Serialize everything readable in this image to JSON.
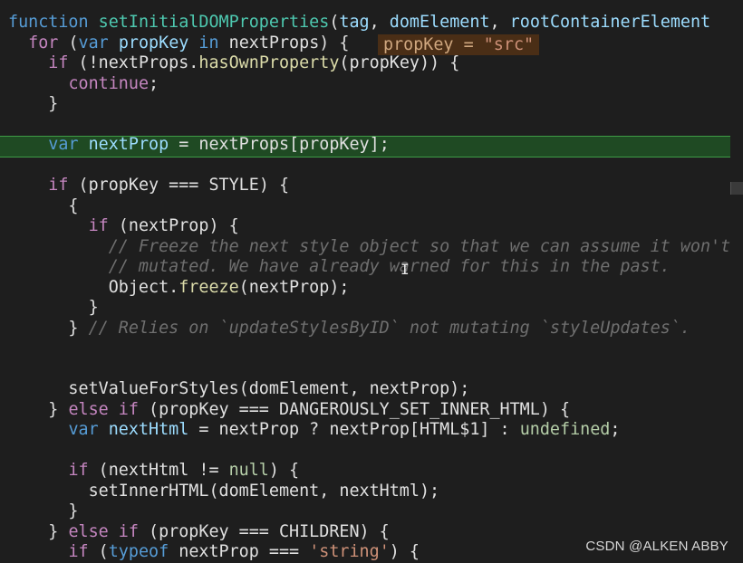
{
  "editor": {
    "language": "javascript",
    "inline_value": {
      "label": "propKey = ",
      "value": "\"src\""
    },
    "watermark": "CSDN @ALKEN  ABBY",
    "cursor_glyph": "I",
    "highlight_color": "#1f4a23",
    "lines": [
      [
        [
          "tk-keyword",
          "function "
        ],
        [
          "tk-function",
          "setInitialDOMProperties"
        ],
        [
          "tk-plain",
          "("
        ],
        [
          "tk-param",
          "tag"
        ],
        [
          "tk-plain",
          ", "
        ],
        [
          "tk-param",
          "domElement"
        ],
        [
          "tk-plain",
          ", "
        ],
        [
          "tk-param",
          "rootContainerElement"
        ]
      ],
      [
        [
          "tk-plain",
          "  "
        ],
        [
          "tk-control",
          "for "
        ],
        [
          "tk-plain",
          "("
        ],
        [
          "tk-keyword",
          "var "
        ],
        [
          "tk-var",
          "propKey "
        ],
        [
          "tk-keyword",
          "in "
        ],
        [
          "tk-plain",
          "nextProps) {"
        ]
      ],
      [
        [
          "tk-plain",
          "    "
        ],
        [
          "tk-control",
          "if "
        ],
        [
          "tk-plain",
          "(!nextProps."
        ],
        [
          "tk-yellowish",
          "hasOwnProperty"
        ],
        [
          "tk-plain",
          "(propKey)) {"
        ]
      ],
      [
        [
          "tk-plain",
          "      "
        ],
        [
          "tk-control",
          "continue"
        ],
        [
          "tk-plain",
          ";"
        ]
      ],
      [
        [
          "tk-plain",
          "    }"
        ]
      ],
      [
        [
          "tk-plain",
          ""
        ]
      ],
      [
        [
          "tk-plain",
          "    "
        ],
        [
          "tk-keyword",
          "var "
        ],
        [
          "tk-var",
          "nextProp "
        ],
        [
          "tk-plain",
          "= nextProps[propKey];"
        ]
      ],
      [
        [
          "tk-plain",
          ""
        ]
      ],
      [
        [
          "tk-plain",
          "    "
        ],
        [
          "tk-control",
          "if "
        ],
        [
          "tk-plain",
          "(propKey === STYLE) {"
        ]
      ],
      [
        [
          "tk-plain",
          "      {"
        ]
      ],
      [
        [
          "tk-plain",
          "        "
        ],
        [
          "tk-control",
          "if "
        ],
        [
          "tk-plain",
          "(nextProp) {"
        ]
      ],
      [
        [
          "tk-comment",
          "          // Freeze the next style object so that we can assume it won't be"
        ]
      ],
      [
        [
          "tk-comment",
          "          // mutated. We have already warned for this in the past."
        ]
      ],
      [
        [
          "tk-plain",
          "          Object."
        ],
        [
          "tk-yellowish",
          "freeze"
        ],
        [
          "tk-plain",
          "(nextProp);"
        ]
      ],
      [
        [
          "tk-plain",
          "        }"
        ]
      ],
      [
        [
          "tk-plain",
          "      } "
        ],
        [
          "tk-comment",
          "// Relies on `updateStylesByID` not mutating `styleUpdates`."
        ]
      ],
      [
        [
          "tk-plain",
          ""
        ]
      ],
      [
        [
          "tk-plain",
          ""
        ]
      ],
      [
        [
          "tk-plain",
          "      setValueForStyles(domElement, nextProp);"
        ]
      ],
      [
        [
          "tk-plain",
          "    } "
        ],
        [
          "tk-control",
          "else if "
        ],
        [
          "tk-plain",
          "(propKey === DANGEROUSLY_SET_INNER_HTML) {"
        ]
      ],
      [
        [
          "tk-plain",
          "      "
        ],
        [
          "tk-keyword",
          "var "
        ],
        [
          "tk-var",
          "nextHtml "
        ],
        [
          "tk-plain",
          "= nextProp ? nextProp[HTML$1] : "
        ],
        [
          "tk-undefined",
          "undefined"
        ],
        [
          "tk-plain",
          ";"
        ]
      ],
      [
        [
          "tk-plain",
          ""
        ]
      ],
      [
        [
          "tk-plain",
          "      "
        ],
        [
          "tk-control",
          "if "
        ],
        [
          "tk-plain",
          "(nextHtml != "
        ],
        [
          "tk-undefined",
          "null"
        ],
        [
          "tk-plain",
          ") {"
        ]
      ],
      [
        [
          "tk-plain",
          "        setInnerHTML(domElement, nextHtml);"
        ]
      ],
      [
        [
          "tk-plain",
          "      }"
        ]
      ],
      [
        [
          "tk-plain",
          "    } "
        ],
        [
          "tk-control",
          "else if "
        ],
        [
          "tk-plain",
          "(propKey === CHILDREN) {"
        ]
      ],
      [
        [
          "tk-plain",
          "      "
        ],
        [
          "tk-control",
          "if "
        ],
        [
          "tk-plain",
          "("
        ],
        [
          "tk-keyword",
          "typeof "
        ],
        [
          "tk-plain",
          "nextProp === "
        ],
        [
          "tk-string",
          "'string'"
        ],
        [
          "tk-plain",
          ") {"
        ]
      ]
    ]
  }
}
